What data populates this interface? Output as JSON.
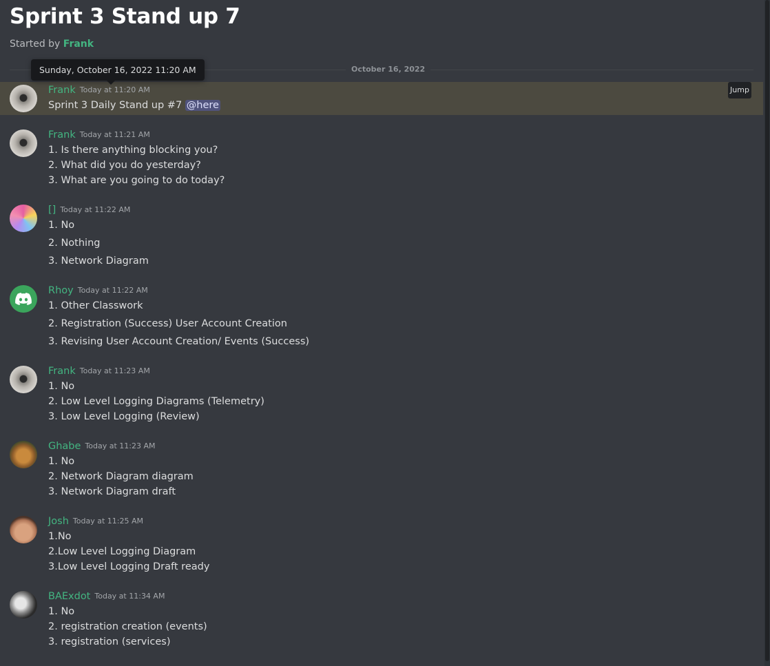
{
  "thread": {
    "title": "Sprint 3 Stand up 7",
    "started_by_label": "Started by",
    "starter": "Frank"
  },
  "divider_date": "October 16, 2022",
  "tooltip": "Sunday, October 16, 2022 11:20 AM",
  "jump_label": "Jump",
  "messages": [
    {
      "author": "Frank",
      "time": "Today at 11:20 AM",
      "avatar": "gray-icon",
      "text": "Sprint 3 Daily Stand up #7",
      "mention": "@here"
    },
    {
      "author": "Frank",
      "time": "Today at 11:21 AM",
      "avatar": "gray-icon",
      "lines": [
        "1. Is there anything blocking you?",
        "2. What did you do yesterday?",
        "3. What are you going to do today?"
      ]
    },
    {
      "author": "[]",
      "time": "Today at 11:22 AM",
      "avatar": "anime-icon",
      "lines": [
        "1. No",
        "2. Nothing",
        "3. Network Diagram"
      ]
    },
    {
      "author": "Rhoy",
      "time": "Today at 11:22 AM",
      "avatar": "discord-icon",
      "lines": [
        "1. Other Classwork",
        "2. Registration (Success) User Account Creation",
        "3. Revising User Account Creation/ Events (Success)"
      ]
    },
    {
      "author": "Frank",
      "time": "Today at 11:23 AM",
      "avatar": "gray-icon",
      "lines": [
        "1. No",
        "2. Low Level Logging Diagrams (Telemetry)",
        "3. Low Level Logging (Review)"
      ]
    },
    {
      "author": "Ghabe",
      "time": "Today at 11:23 AM",
      "avatar": "dog-icon",
      "lines": [
        "1. No",
        "2. Network Diagram diagram",
        "3. Network Diagram draft"
      ]
    },
    {
      "author": "Josh",
      "time": "Today at 11:25 AM",
      "avatar": "face-icon",
      "lines": [
        "1.No",
        "2.Low Level Logging Diagram",
        "3.Low Level Logging Draft ready"
      ]
    },
    {
      "author": "BAExdot",
      "time": "Today at 11:34 AM",
      "avatar": "bw-icon",
      "lines": [
        "1. No",
        "2. registration creation (events)",
        "3. registration (services)"
      ]
    }
  ]
}
